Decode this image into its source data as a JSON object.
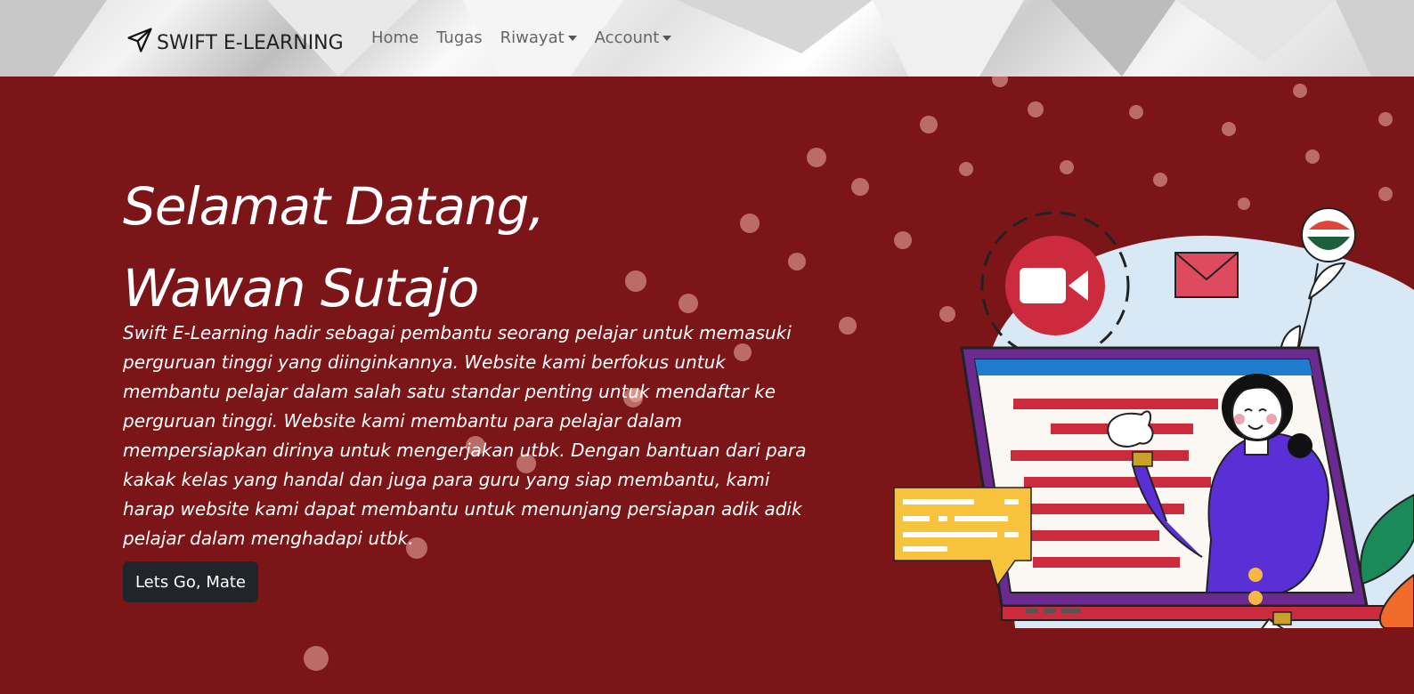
{
  "navbar": {
    "brand": "SWIFT E-LEARNING",
    "links": [
      {
        "label": "Home",
        "dropdown": false
      },
      {
        "label": "Tugas",
        "dropdown": false
      },
      {
        "label": "Riwayat",
        "dropdown": true
      },
      {
        "label": "Account",
        "dropdown": true
      }
    ]
  },
  "hero": {
    "title_line1": "Selamat Datang,",
    "title_line2": "Wawan Sutajo",
    "description": "Swift E-Learning hadir sebagai pembantu seorang pelajar untuk memasuki perguruan tinggi yang diinginkannya. Website kami berfokus untuk membantu pelajar dalam salah satu standar penting untuk mendaftar ke perguruan tinggi. Website kami membantu para pelajar dalam mempersiapkan dirinya untuk mengerjakan utbk. Dengan bantuan dari para kakak kelas yang handal dan juga para guru yang siap membantu, kami harap website kami dapat membantu untuk menunjang persiapan adik adik pelajar dalam menghadapi utbk.",
    "cta_label": "Lets Go, Mate"
  },
  "colors": {
    "hero_bg": "#7c1518",
    "button_bg": "#212529",
    "accent_red": "#cc2a3d",
    "accent_purple": "#5b2fd6"
  },
  "icons": [
    "paper-plane-icon",
    "caret-down-icon",
    "video-camera-icon",
    "envelope-icon"
  ]
}
